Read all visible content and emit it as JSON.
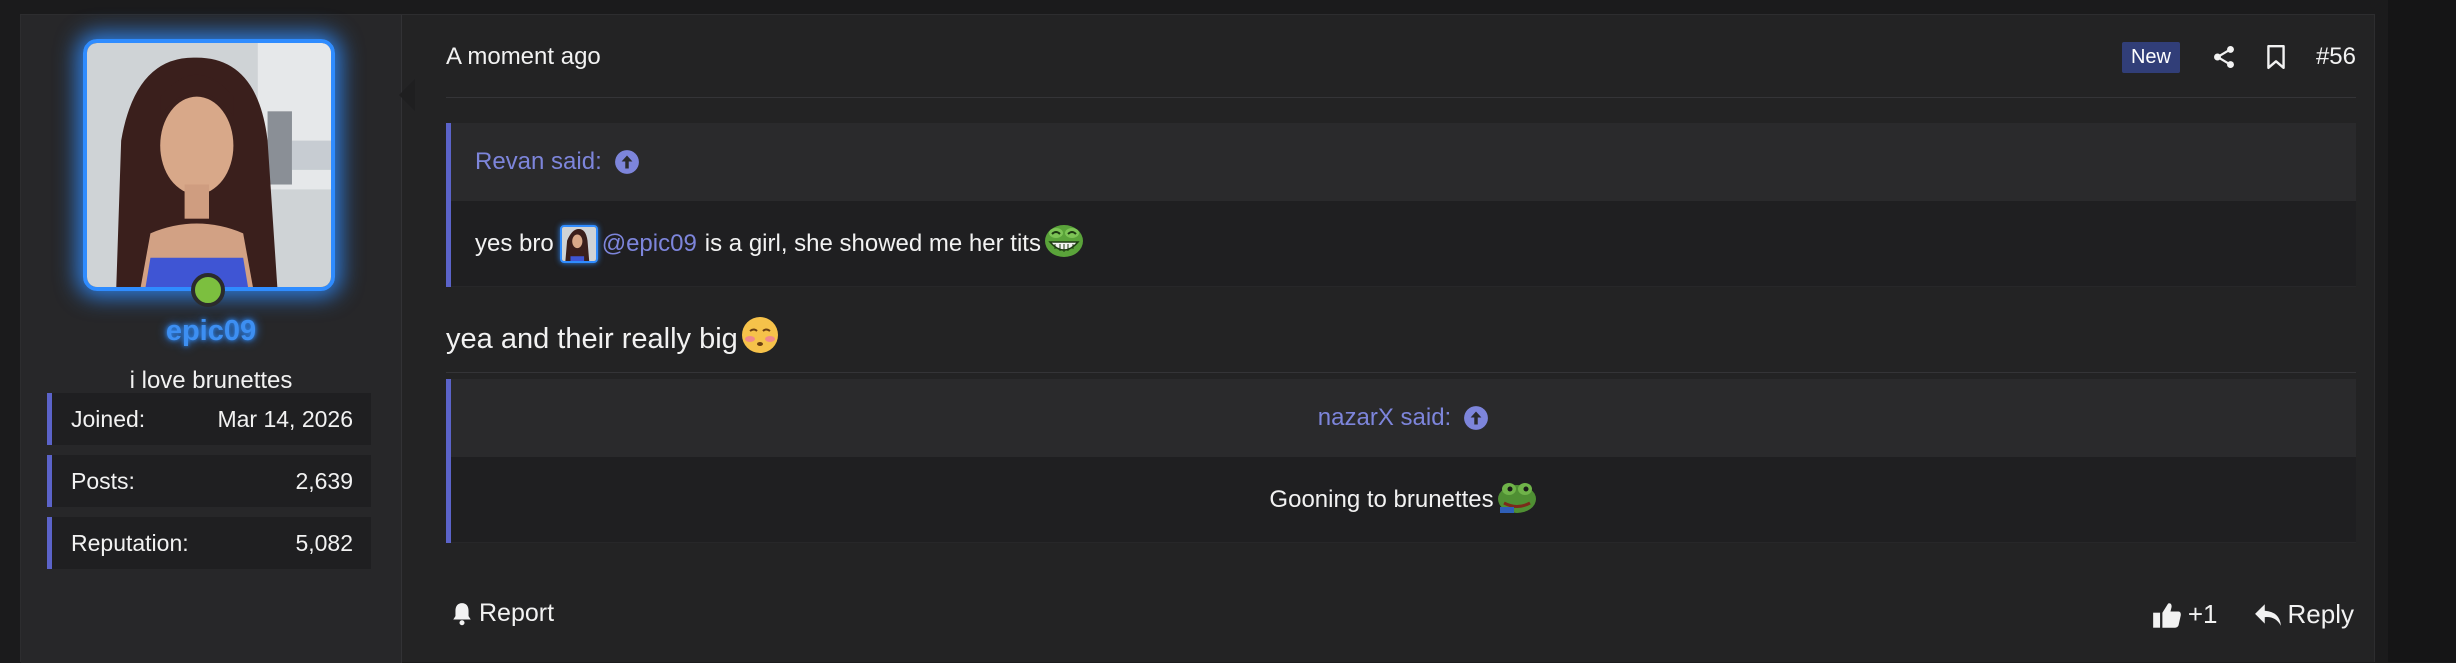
{
  "post": {
    "time": "A moment ago",
    "badge_new": "New",
    "post_number": "#56",
    "reply_text": "yea and their really big",
    "report_label": "Report",
    "like_label": "+1",
    "reply_label": "Reply"
  },
  "user": {
    "name": "epic09",
    "title": "i love brunettes",
    "status": "online",
    "accent_color": "#2f8cff",
    "stats": [
      {
        "label": "Joined:",
        "value": "Mar 14, 2026"
      },
      {
        "label": "Posts:",
        "value": "2,639"
      },
      {
        "label": "Reputation:",
        "value": "5,082"
      }
    ]
  },
  "quotes": [
    {
      "author_said": "Revan said:",
      "text_before": "yes bro",
      "mention": "@epic09",
      "text_after": "is a girl, she showed me her tits",
      "emoji": "pepe-laugh-emoji"
    },
    {
      "author_said": "nazarX said:",
      "text": "Gooning to brunettes",
      "emoji": "pepe-emoji"
    }
  ],
  "colors": {
    "quote_accent": "#5b63c9",
    "link": "#7d85db",
    "badge_bg": "#313e78",
    "online": "#7cbf3f"
  }
}
